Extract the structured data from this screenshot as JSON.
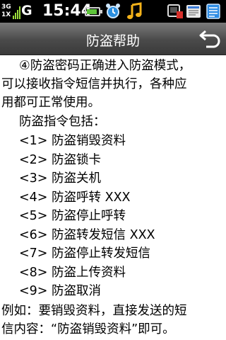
{
  "status_bar": {
    "network_type": "3G",
    "network_sub": "1X",
    "carrier_g": "G",
    "time": "15:44"
  },
  "header": {
    "title": "防盗帮助"
  },
  "content": {
    "paragraph1": [
      "④防盗密码正确进入防盗模式，",
      "可以接收指令短信并执行，各种应",
      "用都可正常使用。"
    ],
    "commands_intro": "防盗指令包括：",
    "commands": [
      "<1> 防盗销毁资料",
      "<2> 防盗锁卡",
      "<3> 防盗关机",
      "<4> 防盗呼转 XXX",
      "<5> 防盗停止呼转",
      "<6> 防盗转发短信 XXX",
      "<7> 防盗停止转发短信",
      "<8> 防盗上传资料",
      "<9> 防盗取消"
    ],
    "example": [
      "例如：要销毁资料，直接发送的短",
      "信内容：“防盗销毁资料”即可。"
    ]
  }
}
